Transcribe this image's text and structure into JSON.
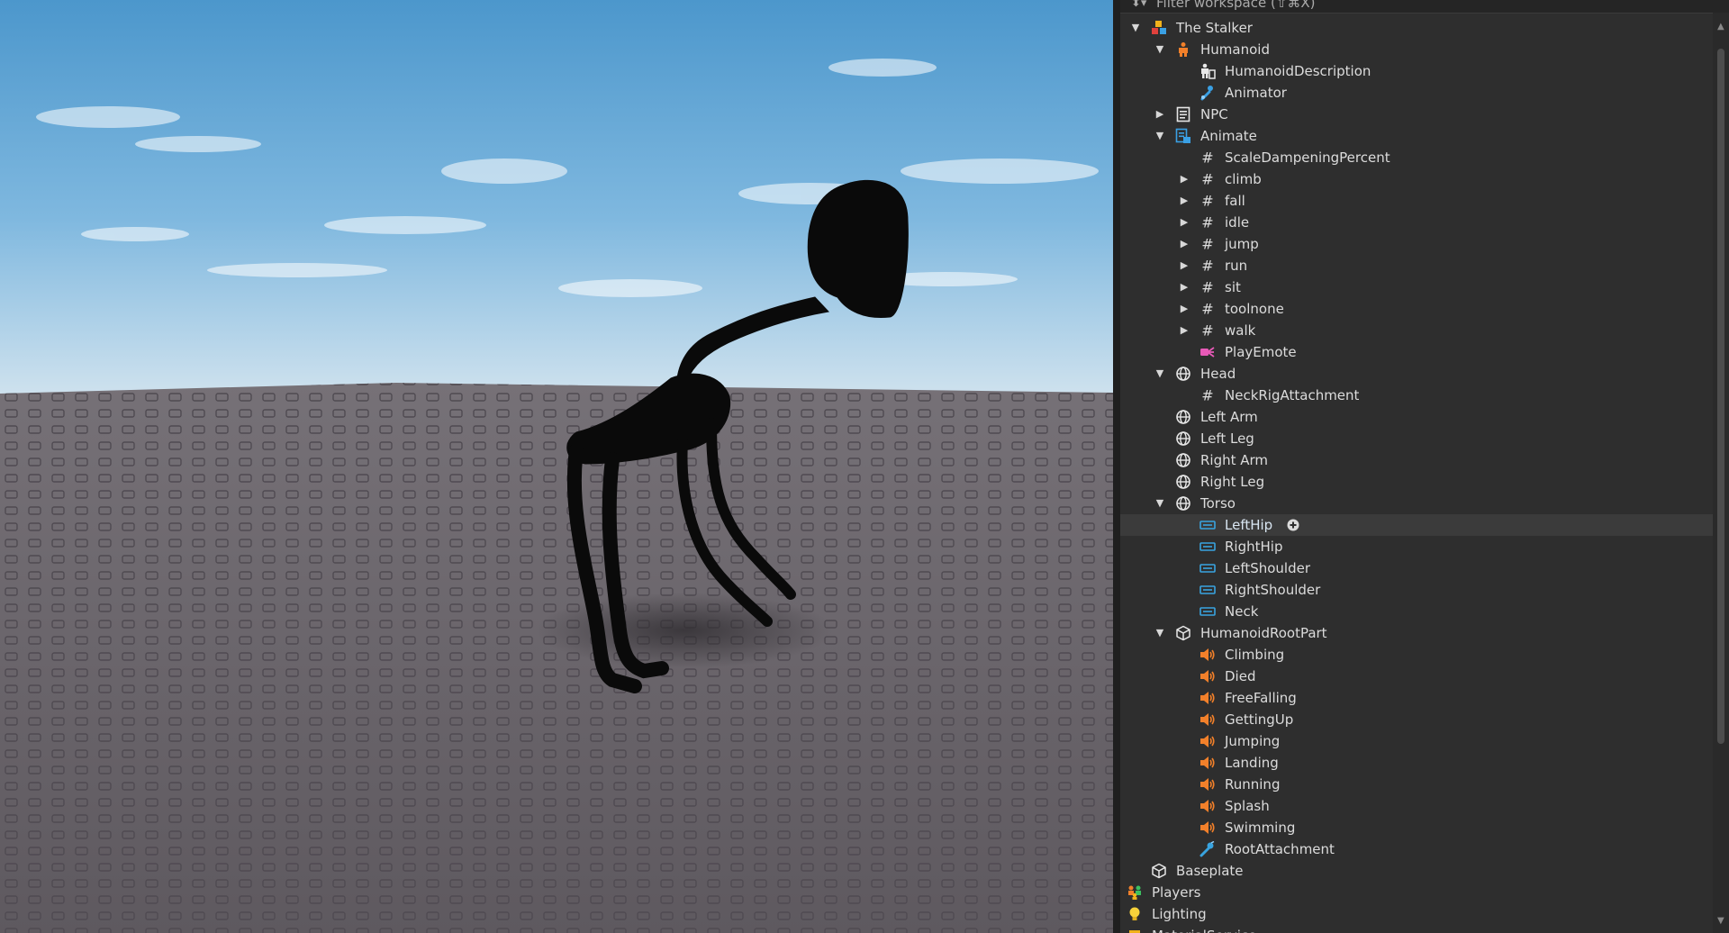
{
  "explorer": {
    "filter_placeholder": "Filter workspace (⇧⌘X)",
    "items": [
      {
        "label": "The Stalker",
        "depth": 0,
        "arrow": "down",
        "icon": "model"
      },
      {
        "label": "Humanoid",
        "depth": 1,
        "arrow": "down",
        "icon": "humanoid"
      },
      {
        "label": "HumanoidDescription",
        "depth": 2,
        "arrow": "",
        "icon": "humanoid-description"
      },
      {
        "label": "Animator",
        "depth": 2,
        "arrow": "",
        "icon": "animator"
      },
      {
        "label": "NPC",
        "depth": 1,
        "arrow": "right",
        "icon": "script"
      },
      {
        "label": "Animate",
        "depth": 1,
        "arrow": "down",
        "icon": "local-script"
      },
      {
        "label": "ScaleDampeningPercent",
        "depth": 2,
        "arrow": "",
        "icon": "value"
      },
      {
        "label": "climb",
        "depth": 2,
        "arrow": "right",
        "icon": "value"
      },
      {
        "label": "fall",
        "depth": 2,
        "arrow": "right",
        "icon": "value"
      },
      {
        "label": "idle",
        "depth": 2,
        "arrow": "right",
        "icon": "value"
      },
      {
        "label": "jump",
        "depth": 2,
        "arrow": "right",
        "icon": "value"
      },
      {
        "label": "run",
        "depth": 2,
        "arrow": "right",
        "icon": "value"
      },
      {
        "label": "sit",
        "depth": 2,
        "arrow": "right",
        "icon": "value"
      },
      {
        "label": "toolnone",
        "depth": 2,
        "arrow": "right",
        "icon": "value"
      },
      {
        "label": "walk",
        "depth": 2,
        "arrow": "right",
        "icon": "value"
      },
      {
        "label": "PlayEmote",
        "depth": 2,
        "arrow": "",
        "icon": "bindable-function"
      },
      {
        "label": "Head",
        "depth": 1,
        "arrow": "down",
        "icon": "mesh-part"
      },
      {
        "label": "NeckRigAttachment",
        "depth": 2,
        "arrow": "",
        "icon": "value"
      },
      {
        "label": "Left Arm",
        "depth": 1,
        "arrow": "",
        "icon": "mesh-part"
      },
      {
        "label": "Left Leg",
        "depth": 1,
        "arrow": "",
        "icon": "mesh-part"
      },
      {
        "label": "Right Arm",
        "depth": 1,
        "arrow": "",
        "icon": "mesh-part"
      },
      {
        "label": "Right Leg",
        "depth": 1,
        "arrow": "",
        "icon": "mesh-part"
      },
      {
        "label": "Torso",
        "depth": 1,
        "arrow": "down",
        "icon": "mesh-part"
      },
      {
        "label": "LeftHip",
        "depth": 2,
        "arrow": "",
        "icon": "motor",
        "selected": true,
        "plus": true
      },
      {
        "label": "RightHip",
        "depth": 2,
        "arrow": "",
        "icon": "motor"
      },
      {
        "label": "LeftShoulder",
        "depth": 2,
        "arrow": "",
        "icon": "motor"
      },
      {
        "label": "RightShoulder",
        "depth": 2,
        "arrow": "",
        "icon": "motor"
      },
      {
        "label": "Neck",
        "depth": 2,
        "arrow": "",
        "icon": "motor"
      },
      {
        "label": "HumanoidRootPart",
        "depth": 1,
        "arrow": "down",
        "icon": "part"
      },
      {
        "label": "Climbing",
        "depth": 2,
        "arrow": "",
        "icon": "sound"
      },
      {
        "label": "Died",
        "depth": 2,
        "arrow": "",
        "icon": "sound"
      },
      {
        "label": "FreeFalling",
        "depth": 2,
        "arrow": "",
        "icon": "sound"
      },
      {
        "label": "GettingUp",
        "depth": 2,
        "arrow": "",
        "icon": "sound"
      },
      {
        "label": "Jumping",
        "depth": 2,
        "arrow": "",
        "icon": "sound"
      },
      {
        "label": "Landing",
        "depth": 2,
        "arrow": "",
        "icon": "sound"
      },
      {
        "label": "Running",
        "depth": 2,
        "arrow": "",
        "icon": "sound"
      },
      {
        "label": "Splash",
        "depth": 2,
        "arrow": "",
        "icon": "sound"
      },
      {
        "label": "Swimming",
        "depth": 2,
        "arrow": "",
        "icon": "sound"
      },
      {
        "label": "RootAttachment",
        "depth": 2,
        "arrow": "",
        "icon": "attachment"
      },
      {
        "label": "Baseplate",
        "depth": 0,
        "arrow": "",
        "icon": "part"
      },
      {
        "label": "Players",
        "depth": -1,
        "arrow": "right",
        "icon": "players"
      },
      {
        "label": "Lighting",
        "depth": -1,
        "arrow": "",
        "icon": "lighting"
      },
      {
        "label": "MaterialService",
        "depth": -1,
        "arrow": "",
        "icon": "material-service"
      }
    ]
  },
  "colors": {
    "sky_top": "#4f99cc",
    "sky_horizon": "#d4e3ec",
    "baseplate": "#6d676e",
    "panel_bg": "#2e2e2e",
    "selected_row": "#3b3b3b",
    "orange": "#f2802a",
    "motor_blue": "#39a4e0"
  }
}
